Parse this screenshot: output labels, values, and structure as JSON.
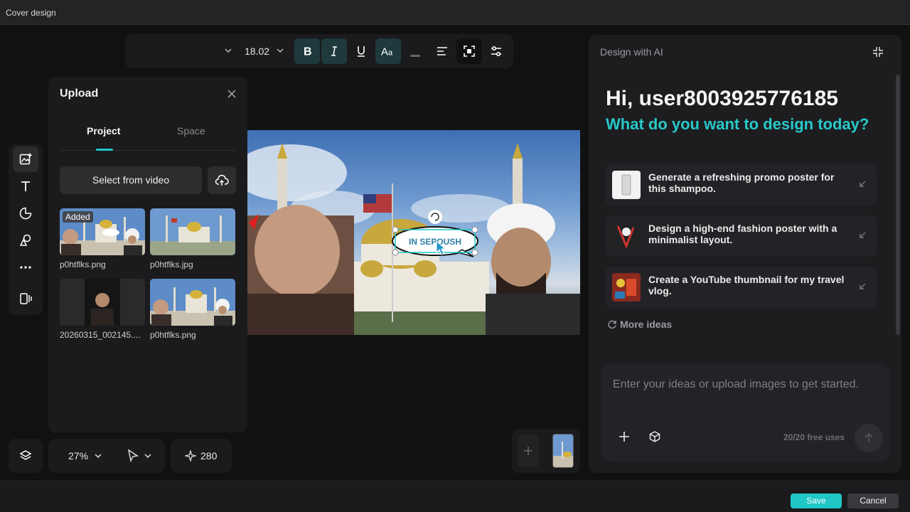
{
  "window": {
    "title": "Cover design"
  },
  "toolbar": {
    "font_value": "",
    "font_size": "18.02",
    "buttons": [
      "bold-icon",
      "italic-icon",
      "underline-icon",
      "text-case-icon",
      "text-color-icon",
      "align-left-icon",
      "crop-icon",
      "adjust-icon"
    ]
  },
  "rail": {
    "items": [
      "image-add-icon",
      "text-icon",
      "sticker-icon",
      "shapes-icon",
      "more-icon",
      "layout-icon"
    ]
  },
  "upload": {
    "title": "Upload",
    "tabs": [
      {
        "label": "Project"
      },
      {
        "label": "Space"
      }
    ],
    "select_video_label": "Select from video",
    "items": [
      {
        "label": "p0htflks.png",
        "badge": "Added"
      },
      {
        "label": "p0htflks.jpg"
      },
      {
        "label": "20260315_002145...."
      },
      {
        "label": "p0htflks.png"
      }
    ]
  },
  "canvas": {
    "text_box": "IN SEPOUSH"
  },
  "zoom": {
    "value": "27%"
  },
  "credits": {
    "value": "280"
  },
  "ai": {
    "header": "Design with AI",
    "greeting": "Hi, user8003925776185",
    "subheading": "What do you want to design today?",
    "ideas": [
      {
        "text": "Generate a refreshing promo poster for this shampoo."
      },
      {
        "text": "Design a high-end fashion poster with a minimalist layout."
      },
      {
        "text": "Create a YouTube thumbnail for my travel vlog."
      }
    ],
    "more_ideas": "More ideas",
    "prompt_placeholder": "Enter your ideas or upload images to get started.",
    "free_uses": "20/20 free uses"
  },
  "footer": {
    "save_label": "Save",
    "cancel_label": "Cancel"
  },
  "colors": {
    "accent": "#21c7c7",
    "panel": "#1b1b1d",
    "background": "#111112"
  }
}
